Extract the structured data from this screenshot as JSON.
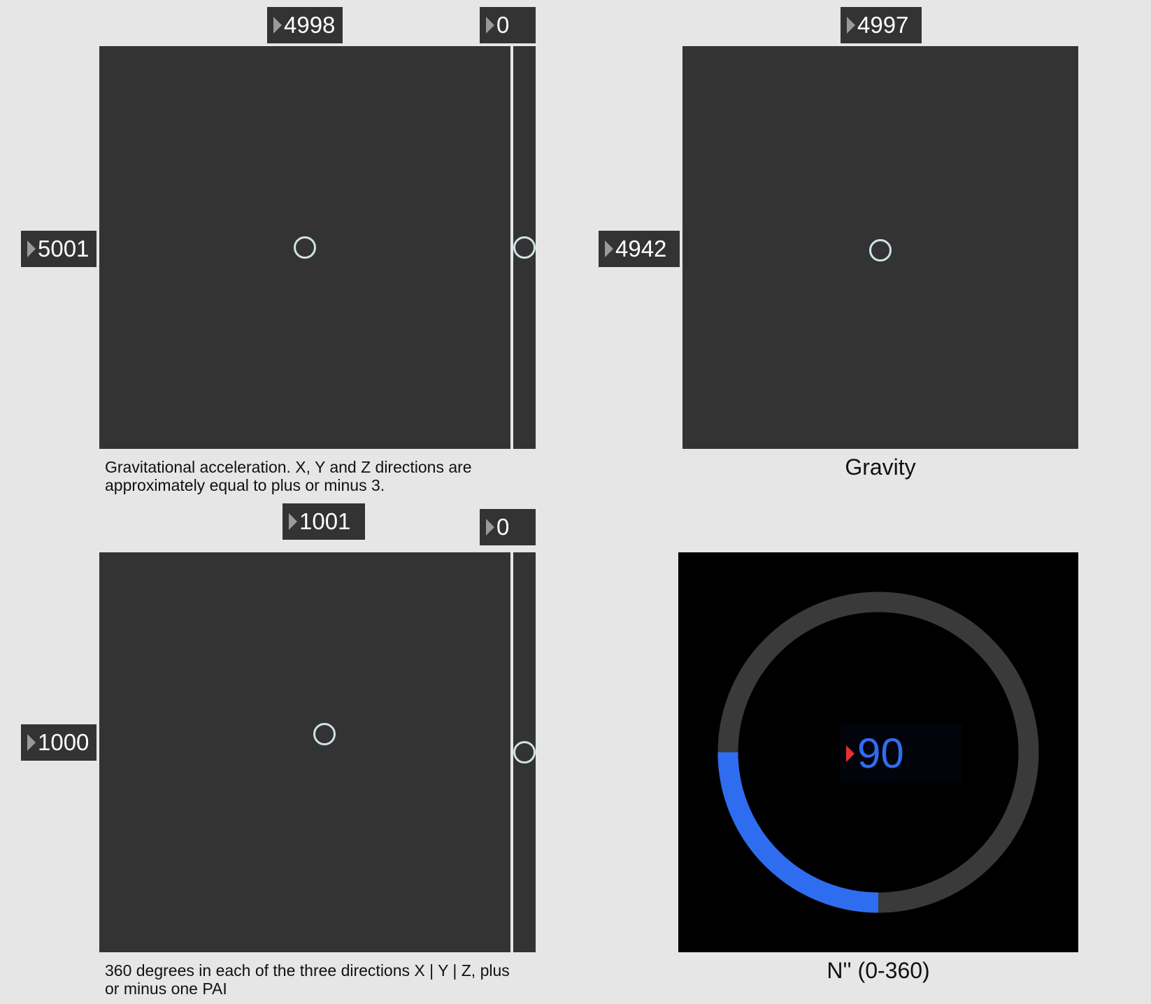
{
  "gravity_panel": {
    "x_value": "4998",
    "z_value": "0",
    "y_value": "5001",
    "caption": "Gravitational acceleration. X, Y and Z directions are approximately equal to plus or minus 3."
  },
  "gravity_pad": {
    "x_value": "4997",
    "y_value": "4942",
    "title": "Gravity"
  },
  "rotation_panel": {
    "x_value": "1001",
    "z_value": "0",
    "y_value": "1000",
    "caption": "360 degrees in each of the three directions X | Y | Z, plus or minus one PAI"
  },
  "dial": {
    "value": "90",
    "level": 90,
    "max": 360,
    "title": "N'' (0-360)",
    "colors": {
      "track": "#3a3a3a",
      "fill": "#2f6df0",
      "arrow": "#e53030"
    }
  }
}
